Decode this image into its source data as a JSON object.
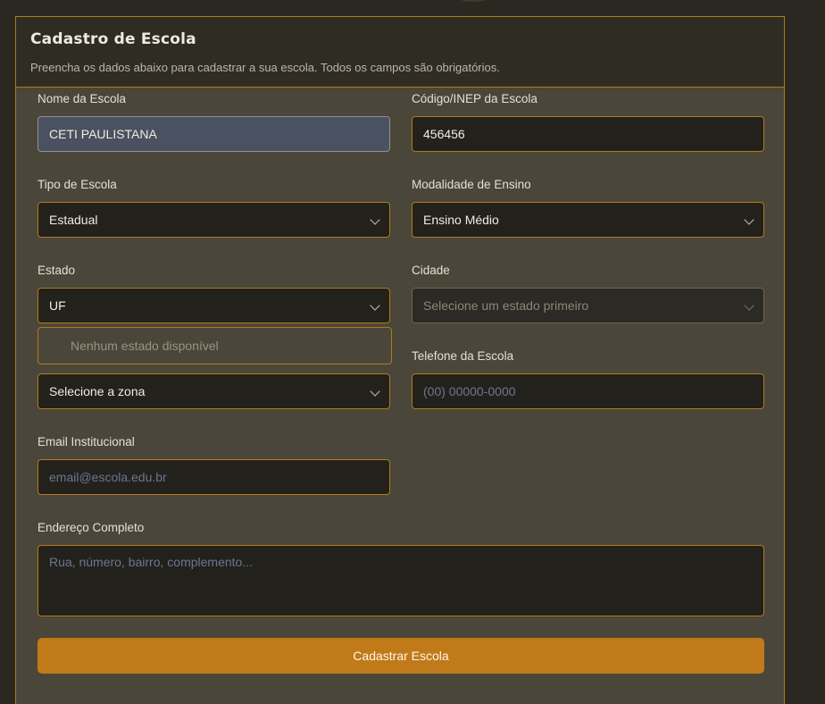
{
  "header": {
    "title": "Cadastro de Escola",
    "subtitle": "Preencha os dados abaixo para cadastrar a sua escola. Todos os campos são obrigatórios."
  },
  "form": {
    "nome": {
      "label": "Nome da Escola",
      "value": "CETI PAULISTANA"
    },
    "codigo": {
      "label": "Código/INEP da Escola",
      "value": "456456"
    },
    "tipo": {
      "label": "Tipo de Escola",
      "value": "Estadual"
    },
    "modalidade": {
      "label": "Modalidade de Ensino",
      "value": "Ensino Médio"
    },
    "estado": {
      "label": "Estado",
      "value": "UF",
      "dropdown_empty": "Nenhum estado disponível"
    },
    "cidade": {
      "label": "Cidade",
      "placeholder": "Selecione um estado primeiro"
    },
    "zona": {
      "value": "Selecione a zona"
    },
    "telefone": {
      "label": "Telefone da Escola",
      "placeholder": "(00) 00000-0000"
    },
    "email": {
      "label": "Email Institucional",
      "placeholder": "email@escola.edu.br"
    },
    "endereco": {
      "label": "Endereço Completo",
      "placeholder": "Rua, número, bairro, complemento..."
    },
    "submit_label": "Cadastrar Escola"
  },
  "colors": {
    "accent": "#c07a1a",
    "border": "#b07b1c",
    "card_bg": "#4a4639",
    "input_bg": "#23211c"
  }
}
